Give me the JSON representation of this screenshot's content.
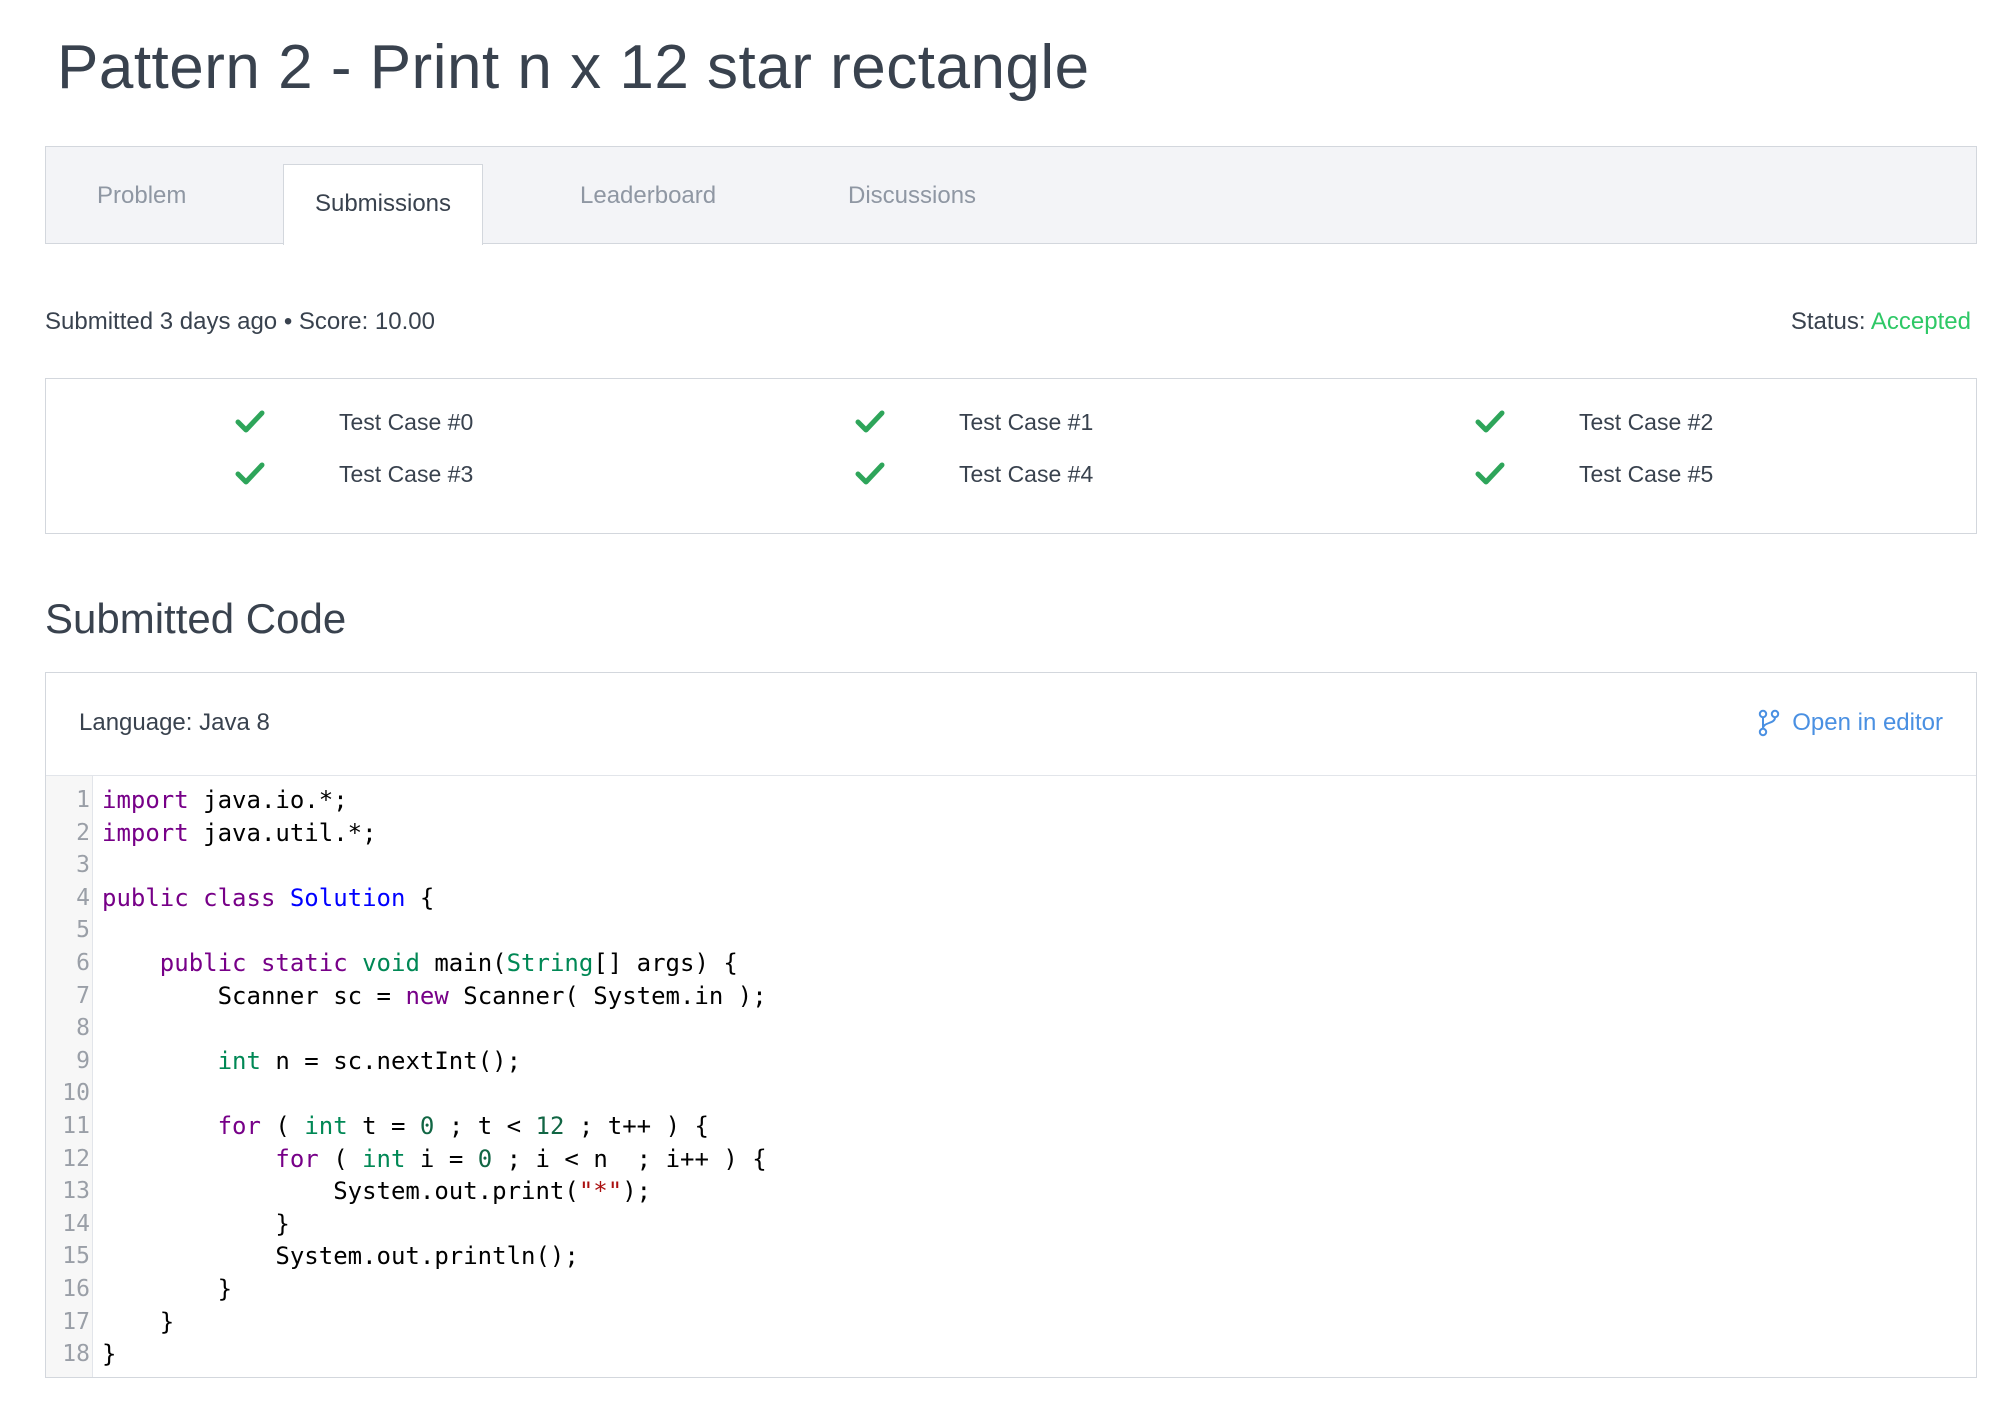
{
  "page": {
    "title": "Pattern 2 - Print n x 12 star rectangle"
  },
  "tabs": [
    {
      "label": "Problem",
      "active": false
    },
    {
      "label": "Submissions",
      "active": true
    },
    {
      "label": "Leaderboard",
      "active": false
    },
    {
      "label": "Discussions",
      "active": false
    }
  ],
  "submission": {
    "summary": "Submitted 3 days ago • Score: 10.00",
    "status_label": "Status:",
    "status_value": "Accepted",
    "status_color": "#2ec866"
  },
  "test_cases": [
    {
      "label": "Test Case #0",
      "icon": "check-icon",
      "passed": true
    },
    {
      "label": "Test Case #1",
      "icon": "check-icon",
      "passed": true
    },
    {
      "label": "Test Case #2",
      "icon": "check-icon",
      "passed": true
    },
    {
      "label": "Test Case #3",
      "icon": "check-icon",
      "passed": true
    },
    {
      "label": "Test Case #4",
      "icon": "check-icon",
      "passed": true
    },
    {
      "label": "Test Case #5",
      "icon": "check-icon",
      "passed": true
    }
  ],
  "code_section": {
    "title": "Submitted Code",
    "language": "Language: Java 8",
    "open_editor_label": "Open in editor",
    "open_editor_icon": "branch-icon",
    "lines": [
      "import java.io.*;",
      "import java.util.*;",
      "",
      "public class Solution {",
      "",
      "    public static void main(String[] args) {",
      "        Scanner sc = new Scanner( System.in );",
      "",
      "        int n = sc.nextInt();",
      "",
      "        for ( int t = 0 ; t < 12 ; t++ ) {",
      "            for ( int i = 0 ; i < n  ; i++ ) {",
      "                System.out.print(\"*\");",
      "            }",
      "            System.out.println();",
      "        }",
      "    }",
      "}"
    ]
  },
  "colors": {
    "accepted": "#2ec866",
    "check": "#2ea55a",
    "link": "#4a90e2",
    "keyword": "#770088",
    "type": "#008855",
    "class": "#0000ff",
    "string": "#aa1111"
  }
}
